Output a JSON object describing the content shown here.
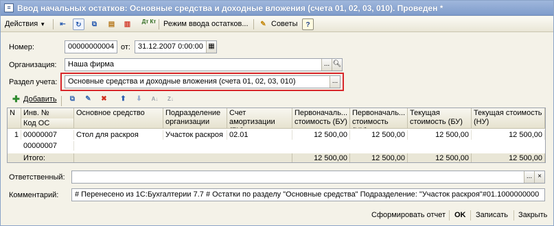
{
  "window": {
    "title": "Ввод начальных остатков: Основные средства и доходные вложения (счета 01, 02, 03, 010). Проведен *"
  },
  "toolbar": {
    "actions_label": "Действия",
    "mode_label": "Режим ввода остатков...",
    "tips_label": "Советы",
    "help_label": "?",
    "dtkt_label": "Дт Кт"
  },
  "form": {
    "number_label": "Номер:",
    "number_value": "00000000004",
    "date_label": "от:",
    "date_value": "31.12.2007  0:00:00",
    "org_label": "Организация:",
    "org_value": "Наша фирма",
    "section_label": "Раздел учета:",
    "section_value": "Основные средства и доходные вложения (счета 01, 02, 03, 010)",
    "select_button": "..."
  },
  "table_toolbar": {
    "add_label": "Добавить"
  },
  "table": {
    "headers": {
      "n": "N",
      "inv": "Инв. №",
      "code": "Код ОС",
      "asset": "Основное средство",
      "dept": "Подразделение организации",
      "account": "Счет амортизации (БУ)",
      "init_bu": "Первоначаль... стоимость (БУ)",
      "init_nu": "Первоначаль... стоимость (НУ)",
      "cur_bu": "Текущая стоимость (БУ)",
      "cur_nu": "Текущая стоимость (НУ)"
    },
    "rows": [
      {
        "n": "1",
        "inv": "00000007",
        "code": "00000007",
        "asset": "Стол для раскроя",
        "dept": "Участок раскроя",
        "account": "02.01",
        "init_bu": "12 500,00",
        "init_nu": "12 500,00",
        "cur_bu": "12 500,00",
        "cur_nu": "12 500,00"
      }
    ],
    "totals": {
      "label": "Итого:",
      "init_bu": "12 500,00",
      "init_nu": "12 500,00",
      "cur_bu": "12 500,00",
      "cur_nu": "12 500,00"
    }
  },
  "responsible": {
    "label": "Ответственный:",
    "value": ""
  },
  "comment": {
    "label": "Комментарий:",
    "value": "# Перенесено из 1С:Бухгалтерии 7.7 # Остатки по разделу \"Основные средства\" Подразделение: \"Участок раскроя\"#01.1000000000"
  },
  "footer": {
    "report_label": "Сформировать отчет",
    "ok_label": "OK",
    "save_label": "Записать",
    "close_label": "Закрыть"
  },
  "colors": {
    "highlight_frame": "#d8262a",
    "titlebar": "#8aa6d2"
  }
}
